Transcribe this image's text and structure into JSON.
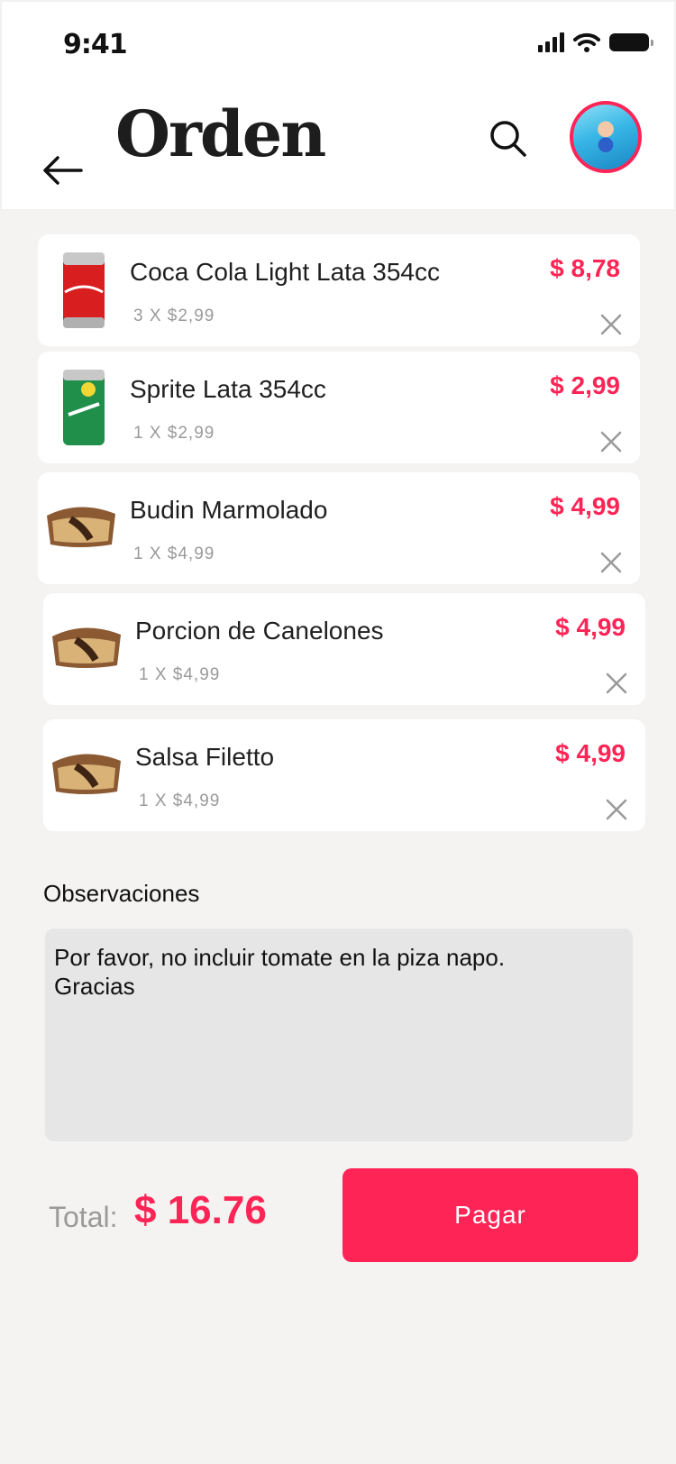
{
  "status_bar": {
    "time": "9:41"
  },
  "header": {
    "title": "Orden"
  },
  "items": [
    {
      "name": "Coca Cola Light Lata 354cc",
      "qty": "3 X $2,99",
      "price": "$ 8,78",
      "thumb": "coke-can-icon"
    },
    {
      "name": "Sprite Lata 354cc",
      "qty": "1 X $2,99",
      "price": "$ 2,99",
      "thumb": "sprite-can-icon"
    },
    {
      "name": "Budin Marmolado",
      "qty": "1 X $4,99",
      "price": "$ 4,99",
      "thumb": "cake-icon"
    },
    {
      "name": "Porcion de Canelones",
      "qty": "1 X $4,99",
      "price": "$ 4,99",
      "thumb": "cake-icon"
    },
    {
      "name": "Salsa Filetto",
      "qty": "1 X $4,99",
      "price": "$ 4,99",
      "thumb": "cake-icon"
    }
  ],
  "notes": {
    "label": "Observaciones",
    "line1": "Por favor, no incluir tomate en la piza napo.",
    "line2": "Gracias"
  },
  "footer": {
    "total_label": "Total:",
    "total_value": "$ 16.76",
    "pay_label": "Pagar"
  },
  "colors": {
    "accent": "#ff2456",
    "notes_bg": "#e6e6e6",
    "page_bg": "#f4f3f2"
  }
}
